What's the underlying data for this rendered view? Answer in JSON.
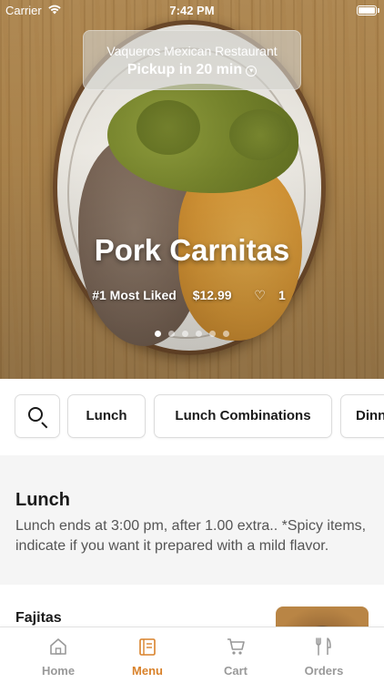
{
  "status_bar": {
    "carrier": "Carrier",
    "time": "7:42 PM"
  },
  "pickup": {
    "restaurant": "Vaqueros Mexican Restaurant",
    "label": "Pickup in 20 min"
  },
  "featured": {
    "name": "Pork Carnitas",
    "rank": "#1 Most Liked",
    "price": "$12.99",
    "likes": "1",
    "slide_count": 6,
    "active_slide": 1
  },
  "categories": {
    "items": [
      "Lunch",
      "Lunch Combinations",
      "Dinn"
    ]
  },
  "section": {
    "title": "Lunch",
    "description": "Lunch ends at 3:00 pm, after 1.00 extra.. *Spicy items, indicate if you want it prepared with a mild flavor."
  },
  "items": [
    {
      "name": "Fajitas"
    }
  ],
  "tabs": [
    {
      "label": "Home",
      "icon": "home-icon"
    },
    {
      "label": "Menu",
      "icon": "menu-icon",
      "active": true
    },
    {
      "label": "Cart",
      "icon": "cart-icon"
    },
    {
      "label": "Orders",
      "icon": "orders-icon"
    }
  ],
  "colors": {
    "accent": "#d9822b",
    "inactive": "#999999"
  }
}
